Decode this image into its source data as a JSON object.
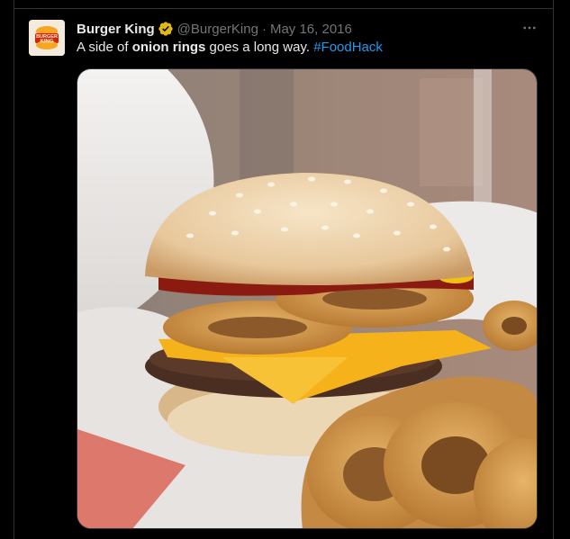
{
  "tweet": {
    "display_name": "Burger King",
    "handle": "@BurgerKing",
    "separator": "·",
    "date": "May 16, 2016",
    "text_parts": {
      "pre": "A side of ",
      "bold": "onion rings",
      "post": " goes a long way. ",
      "hashtag": "#FoodHack"
    },
    "avatar_logo_text": [
      "BURGER",
      "KING"
    ],
    "icons": {
      "verified": "verified-badge-icon",
      "more": "more-dots-icon"
    }
  },
  "colors": {
    "background": "#000000",
    "text": "#e7e9ea",
    "muted": "#71767b",
    "link": "#1d9bf0",
    "verified_gold": "#e2b719",
    "border": "#2f3336",
    "bk_red": "#d62300",
    "bk_orange": "#f5a623"
  }
}
